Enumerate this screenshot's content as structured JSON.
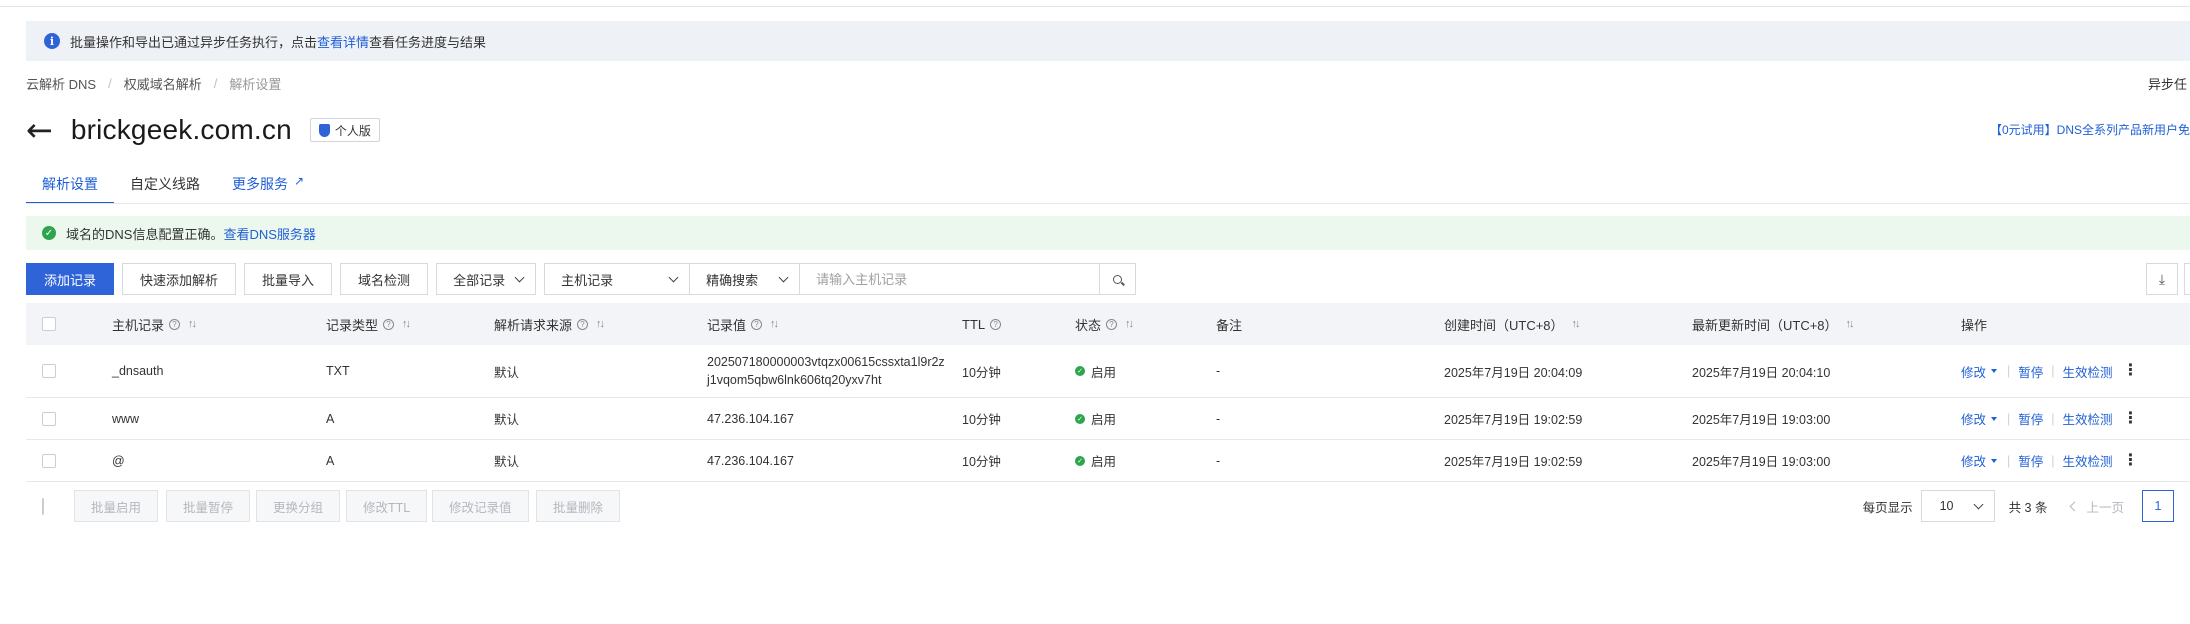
{
  "notice": {
    "text_before": "批量操作和导出已通过异步任务执行，点击",
    "link": "查看详情",
    "text_after": "查看任务进度与结果"
  },
  "breadcrumb": [
    "云解析 DNS",
    "权威域名解析",
    "解析设置"
  ],
  "right_async": "异步任",
  "header": {
    "domain": "brickgeek.com.cn",
    "edition": "个人版",
    "promo": "【0元试用】DNS全系列产品新用户免"
  },
  "tabs": [
    {
      "label": "解析设置",
      "active": true
    },
    {
      "label": "自定义线路",
      "active": false
    },
    {
      "label": "更多服务",
      "active": false
    }
  ],
  "success": {
    "text": "域名的DNS信息配置正确。",
    "link": "查看DNS服务器"
  },
  "toolbar": {
    "add": "添加记录",
    "quick_add": "快速添加解析",
    "import": "批量导入",
    "check": "域名检测",
    "all_records": "全部记录",
    "host_record": "主机记录",
    "precise_search": "精确搜索",
    "search_placeholder": "请输入主机记录"
  },
  "columns": {
    "host": "主机记录",
    "type": "记录类型",
    "source": "解析请求来源",
    "value": "记录值",
    "ttl": "TTL",
    "status": "状态",
    "remark": "备注",
    "created": "创建时间（UTC+8）",
    "updated": "最新更新时间（UTC+8）",
    "actions": "操作"
  },
  "rows": [
    {
      "host": "_dnsauth",
      "type": "TXT",
      "source": "默认",
      "value_line1": "202507180000003vtqzx00615cssxta1l9r2z",
      "value_line2": "j1vqom5qbw6lnk606tq20yxv7ht",
      "ttl": "10分钟",
      "status": "启用",
      "remark": "-",
      "created": "2025年7月19日 20:04:09",
      "updated": "2025年7月19日 20:04:10"
    },
    {
      "host": "www",
      "type": "A",
      "source": "默认",
      "value_line1": "47.236.104.167",
      "ttl": "10分钟",
      "status": "启用",
      "remark": "-",
      "created": "2025年7月19日 19:02:59",
      "updated": "2025年7月19日 19:03:00"
    },
    {
      "host": "@",
      "type": "A",
      "source": "默认",
      "value_line1": "47.236.104.167",
      "ttl": "10分钟",
      "status": "启用",
      "remark": "-",
      "created": "2025年7月19日 19:02:59",
      "updated": "2025年7月19日 19:03:00"
    }
  ],
  "row_actions": {
    "modify": "修改",
    "pause": "暂停",
    "verify": "生效检测"
  },
  "bulk": {
    "enable": "批量启用",
    "pause": "批量暂停",
    "group": "更换分组",
    "ttl": "修改TTL",
    "value": "修改记录值",
    "delete": "批量删除"
  },
  "pager": {
    "per_page_label": "每页显示",
    "page_size": "10",
    "total": "共 3 条",
    "prev": "上一页",
    "current_page": "1"
  }
}
